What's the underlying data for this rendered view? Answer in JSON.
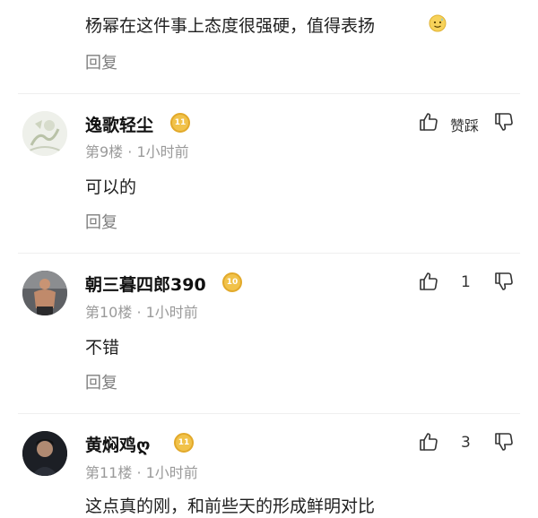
{
  "top_comment": {
    "text": "杨幂在这件事上态度很强硬，值得表扬",
    "emoji": "sweat-smile-emoji",
    "reply_label": "回复"
  },
  "comments": [
    {
      "username": "逸歌轻尘",
      "level": "11",
      "floor_time": "第9楼 · 1小时前",
      "text": "可以的",
      "like_label": "赞踩",
      "reply_label": "回复",
      "avatar": "sketch-illustration-avatar"
    },
    {
      "username": "朝三暮四郎390",
      "level": "10",
      "floor_time": "第10楼 · 1小时前",
      "text": "不错",
      "like_count": "1",
      "reply_label": "回复",
      "avatar": "shirtless-man-avatar"
    },
    {
      "username": "黄焖鸡ღ",
      "level": "11",
      "floor_time": "第11楼 · 1小时前",
      "text": "这点真的刚，和前些天的形成鲜明对比",
      "like_count": "3",
      "avatar": "dark-portrait-avatar"
    }
  ],
  "colors": {
    "badge": "#f1c24a",
    "meta_text": "#9a9a9a",
    "reply_text": "#7e7e7e"
  }
}
